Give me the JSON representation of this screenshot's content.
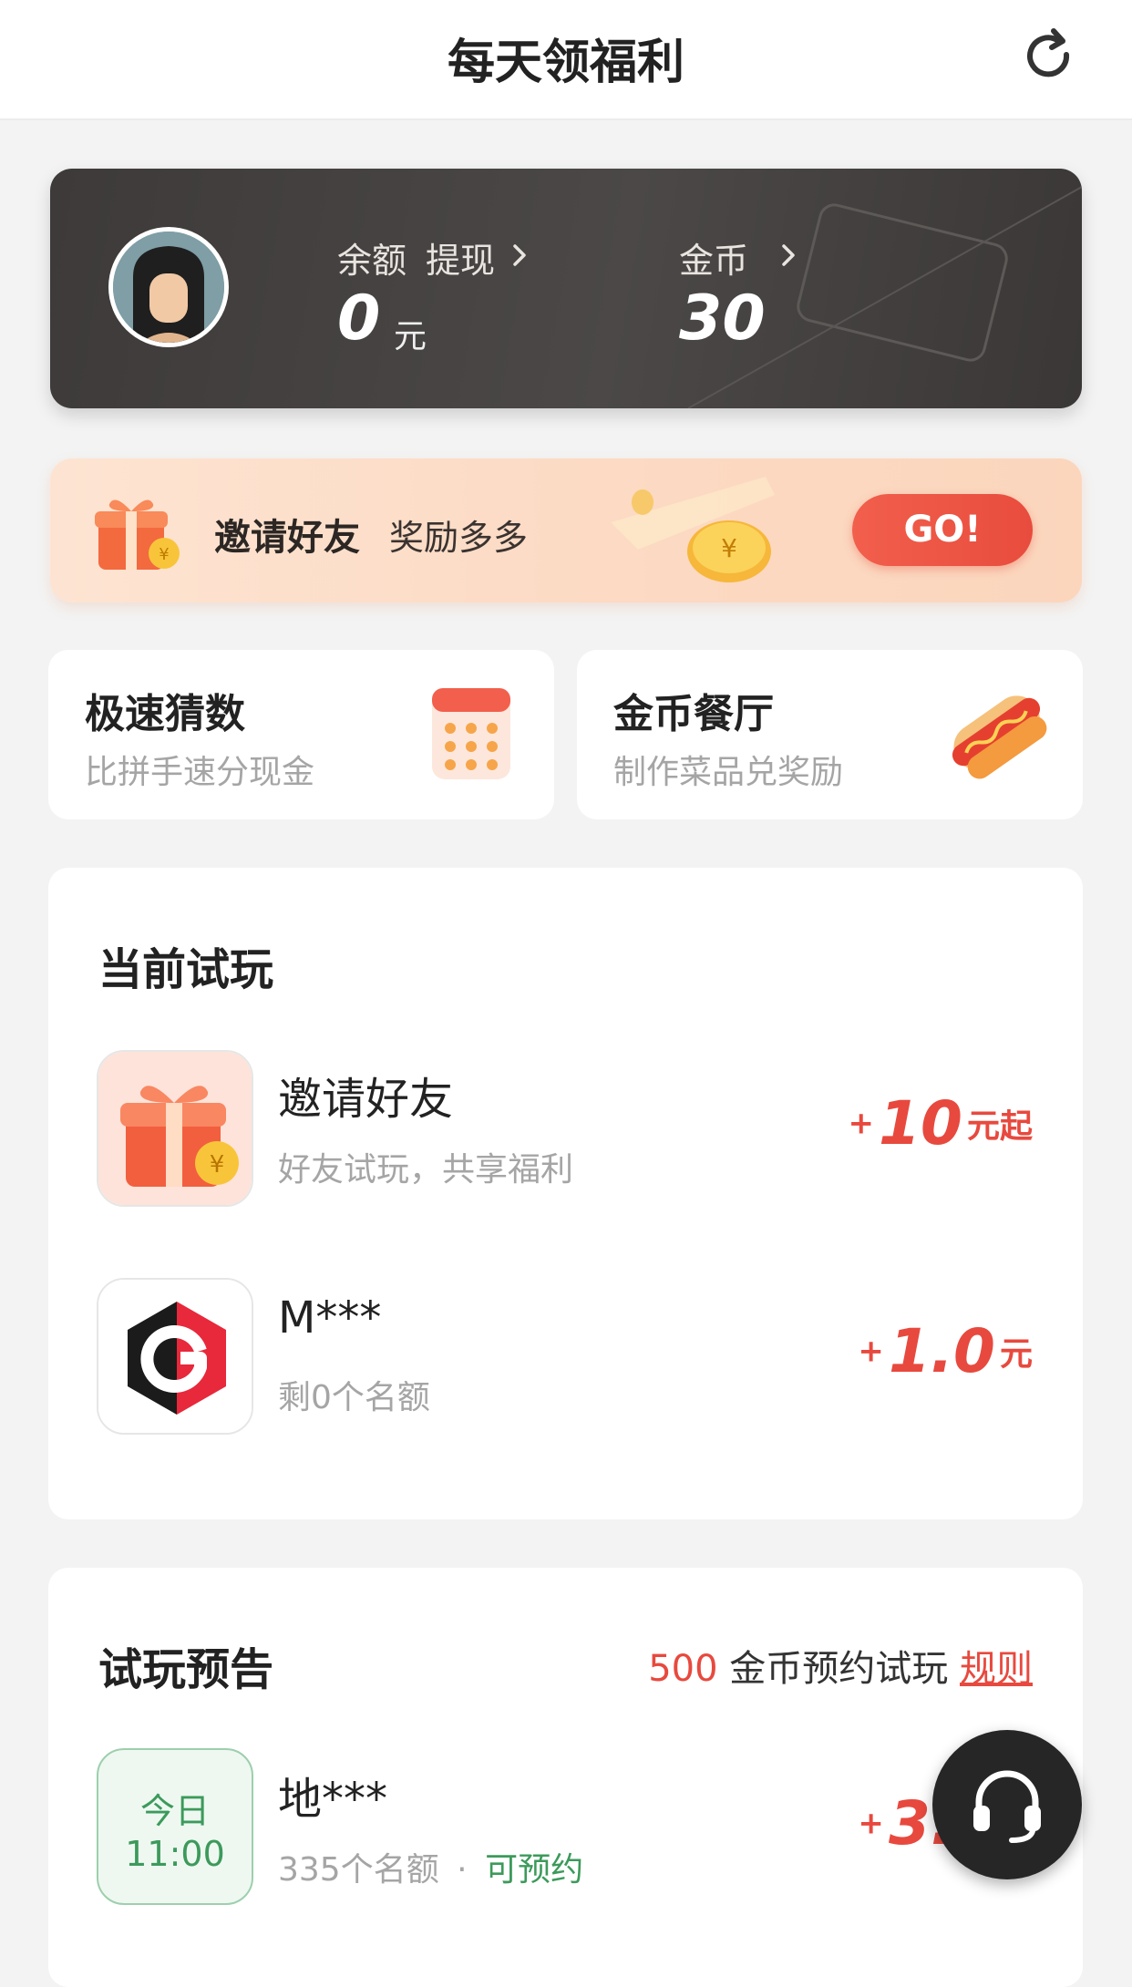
{
  "header": {
    "title": "每天领福利",
    "refresh_icon": "refresh-icon"
  },
  "wallet": {
    "balance_label": "余额",
    "withdraw_label": "提现",
    "balance_value": "0",
    "balance_unit": "元",
    "coins_label": "金币",
    "coins_value": "30"
  },
  "invite_banner": {
    "title": "邀请好友",
    "subtitle": "奖励多多",
    "button": "GO!"
  },
  "tiles": [
    {
      "title": "极速猜数",
      "subtitle": "比拼手速分现金",
      "icon": "calculator-icon"
    },
    {
      "title": "金币餐厅",
      "subtitle": "制作菜品兑奖励",
      "icon": "hotdog-icon"
    }
  ],
  "current_trials": {
    "title": "当前试玩",
    "items": [
      {
        "name": "邀请好友",
        "subtitle": "好友试玩，共享福利",
        "plus": "+",
        "amount": "10",
        "unit": "元起",
        "icon": "gift-icon"
      },
      {
        "name": "M***",
        "subtitle": "剩0个名额",
        "plus": "+",
        "amount": "1.0",
        "unit": "元",
        "icon": "g-logo-icon"
      }
    ]
  },
  "upcoming": {
    "title": "试玩预告",
    "coins_amount": "500",
    "coins_text": "金币预约试玩",
    "rules_link": "规则",
    "items": [
      {
        "day": "今日",
        "time": "11:00",
        "name": "地***",
        "slots": "335个名额",
        "separator": "·",
        "status": "可预约",
        "plus": "+",
        "amount": "3.0",
        "unit": "元"
      }
    ]
  },
  "colors": {
    "accent_red": "#e8493e",
    "accent_green": "#3c9a5b",
    "card_dark": "#444141"
  },
  "float_button": {
    "icon": "headset-icon"
  }
}
